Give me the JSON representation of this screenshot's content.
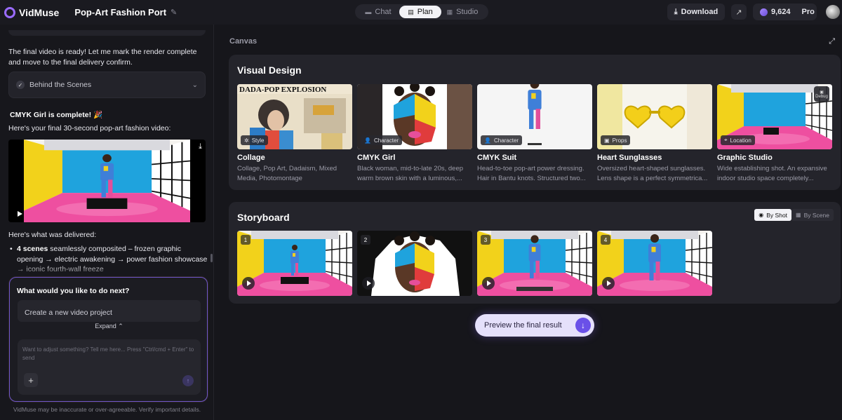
{
  "header": {
    "app_name": "VidMuse",
    "project_title": "Pop-Art Fashion Port",
    "modes": [
      {
        "label": "Chat",
        "icon": "chat-icon",
        "active": false
      },
      {
        "label": "Plan",
        "icon": "plan-icon",
        "active": true
      },
      {
        "label": "Studio",
        "icon": "studio-icon",
        "active": false
      }
    ],
    "download_label": "Download",
    "credits": "9,624",
    "plan_tier": "Pro"
  },
  "chat": {
    "message_intro": "The final video is ready! Let me mark the render complete and move to the final delivery confirm.",
    "behind_scenes_label": "Behind the Scenes",
    "complete_title": "CMYK Girl is complete! 🎉",
    "final_line": "Here's your final 30-second pop-art fashion video:",
    "delivered_line": "Here's what was delivered:",
    "bullet_bold": "4 scenes",
    "bullet_text": " seamlessly composited – frozen graphic opening → electric awakening → power fashion showcase → iconic fourth-wall freeze",
    "next_title": "What would you like to do next?",
    "suggestion": "Create a new video project",
    "expand_label": "Expand",
    "prompt_placeholder": "Want to adjust something? Tell me here... Press \"Ctrl/cmd + Enter\" to send",
    "disclaimer": "VidMuse may be inaccurate or over-agreeable. Verify important details."
  },
  "canvas": {
    "label": "Canvas",
    "visual_design": {
      "title": "Visual Design",
      "debug_label": "Debug",
      "cards": [
        {
          "tag": "Style",
          "tag_icon": "style-icon",
          "title": "Collage",
          "desc1": "Collage, Pop Art, Dadaism, Mixed",
          "desc2": "Media, Photomontage",
          "collage_text": "DADA-POP EXPLOSION"
        },
        {
          "tag": "Character",
          "tag_icon": "person-icon",
          "title": "CMYK Girl",
          "desc1": "Black woman, mid-to-late 20s, deep",
          "desc2": "warm brown skin with a luminous,..."
        },
        {
          "tag": "Character",
          "tag_icon": "person-icon",
          "title": "CMYK Suit",
          "desc1": "Head-to-toe pop-art power dressing.",
          "desc2": "Hair in Bantu knots. Structured two..."
        },
        {
          "tag": "Props",
          "tag_icon": "props-icon",
          "title": "Heart Sunglasses",
          "desc1": "Oversized heart-shaped sunglasses.",
          "desc2": "Lens shape is a perfect symmetrica..."
        },
        {
          "tag": "Location",
          "tag_icon": "location-icon",
          "title": "Graphic Studio",
          "desc1": "Wide establishing shot. An expansive",
          "desc2": "indoor studio space completely..."
        }
      ]
    },
    "storyboard": {
      "title": "Storyboard",
      "toggle": [
        {
          "label": "By Shot",
          "active": true
        },
        {
          "label": "By Scene",
          "active": false
        }
      ],
      "shots": [
        "1",
        "2",
        "3",
        "4"
      ]
    },
    "preview_label": "Preview the final result"
  },
  "colors": {
    "accent": "#6a50e8",
    "bg": "#16161b",
    "panel": "#24242b"
  }
}
